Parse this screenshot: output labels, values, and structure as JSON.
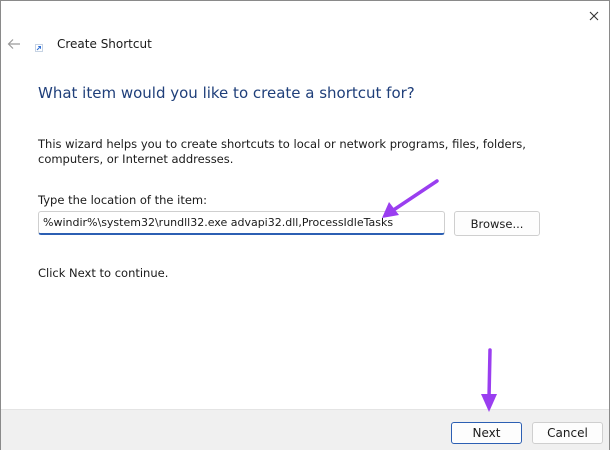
{
  "window": {
    "title": "Create Shortcut",
    "close_icon": "close-icon",
    "back_icon": "back-arrow-icon",
    "app_icon": "shortcut-icon"
  },
  "wizard": {
    "heading": "What item would you like to create a shortcut for?",
    "description": "This wizard helps you to create shortcuts to local or network programs, files, folders, computers, or Internet addresses.",
    "location_label": "Type the location of the item:",
    "location_value": "%windir%\\system32\\rundll32.exe advapi32.dll,ProcessIdleTasks",
    "browse_label": "Browse...",
    "continue_text": "Click Next to continue."
  },
  "footer": {
    "next_label": "Next",
    "cancel_label": "Cancel"
  },
  "annotations": {
    "arrow_color": "#9a3ef0"
  }
}
